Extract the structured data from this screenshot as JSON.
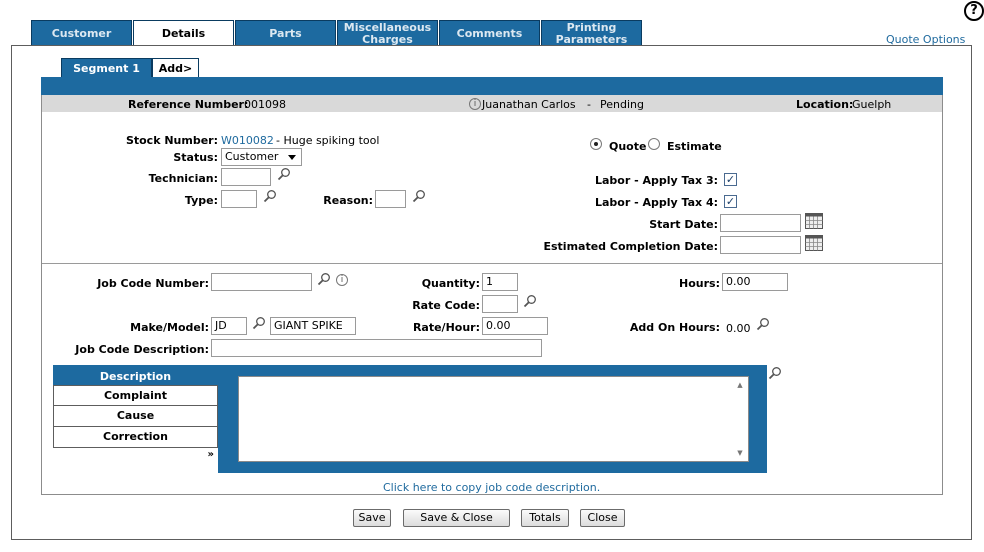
{
  "help_icon": "?",
  "tabs": [
    {
      "label": "Customer"
    },
    {
      "label": "Details"
    },
    {
      "label": "Parts"
    },
    {
      "label": "Miscellaneous Charges"
    },
    {
      "label": "Comments"
    },
    {
      "label": "Printing Parameters"
    }
  ],
  "quote_options": "Quote Options",
  "segment_tabs": {
    "segment": "Segment 1",
    "add": "Add>"
  },
  "header": {
    "reference_label": "Reference Number:",
    "reference_value": "001098",
    "customer": "Juanathan Carlos",
    "separator": "-",
    "status": "Pending",
    "location_label": "Location:",
    "location_value": "Guelph"
  },
  "details": {
    "stock_label": "Stock Number:",
    "stock_number": "W010082",
    "stock_desc": "- Huge spiking tool",
    "status_label": "Status:",
    "status_value": "Customer",
    "technician_label": "Technician:",
    "type_label": "Type:",
    "reason_label": "Reason:",
    "quote_label": "Quote",
    "estimate_label": "Estimate",
    "tax3_label": "Labor - Apply Tax 3:",
    "tax4_label": "Labor - Apply Tax 4:",
    "start_date_label": "Start Date:",
    "est_completion_label": "Estimated Completion Date:"
  },
  "job": {
    "job_code_label": "Job Code Number:",
    "quantity_label": "Quantity:",
    "quantity_value": "1",
    "hours_label": "Hours:",
    "hours_value": "0.00",
    "rate_code_label": "Rate Code:",
    "make_model_label": "Make/Model:",
    "make_value": "JD",
    "model_value": "GIANT SPIKE",
    "rate_hour_label": "Rate/Hour:",
    "rate_hour_value": "0.00",
    "add_on_hours_label": "Add On Hours:",
    "add_on_hours_value": "0.00",
    "job_desc_label": "Job Code Description:"
  },
  "description_panel": {
    "header": "Description",
    "items": [
      "Complaint",
      "Cause",
      "Correction"
    ],
    "more": "»"
  },
  "copy_link": "Click here to copy job code description.",
  "buttons": {
    "save": "Save",
    "save_close": "Save & Close",
    "totals": "Totals",
    "close": "Close"
  }
}
